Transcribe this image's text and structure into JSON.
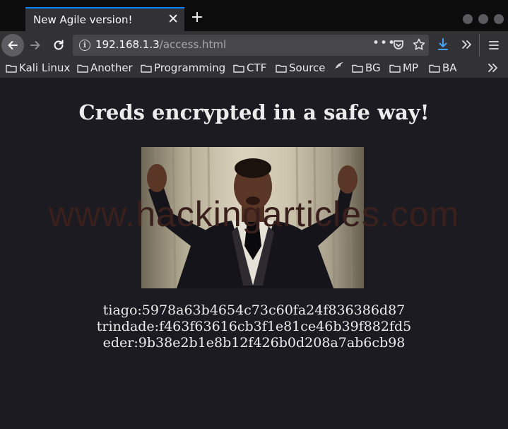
{
  "browser": {
    "tab_title": "New Agile version!",
    "tab_close_glyph": "✕",
    "new_tab_glyph": "+",
    "url_host": "192.168.1.3",
    "url_path": "/access.html",
    "url_actions_glyph": "•••",
    "bookmarks": [
      {
        "label": "Kali Linux",
        "icon": "folder-icon"
      },
      {
        "label": "Another",
        "icon": "folder-icon"
      },
      {
        "label": "Programming",
        "icon": "folder-icon"
      },
      {
        "label": "CTF",
        "icon": "folder-icon"
      },
      {
        "label": "Source",
        "icon": "folder-icon"
      },
      {
        "label": "",
        "icon": "dragon-icon"
      },
      {
        "label": "BG",
        "icon": "folder-icon"
      },
      {
        "label": "MP",
        "icon": "folder-icon"
      },
      {
        "label": "BA",
        "icon": "folder-icon"
      }
    ],
    "accent_color": "#0a84ff"
  },
  "page": {
    "heading": "Creds encrypted in a safe way!",
    "watermark": "www.hackingarticles.com",
    "photo_alt": "man in tuxedo with raised hands",
    "credentials": [
      "tiago:5978a63b4654c73c60fa24f836386d87",
      "trindade:f463f63616cb3f1e81ce46b39f882fd5",
      "eder:9b38e2b1e8b12f426b0d208a7ab6cb98"
    ]
  }
}
